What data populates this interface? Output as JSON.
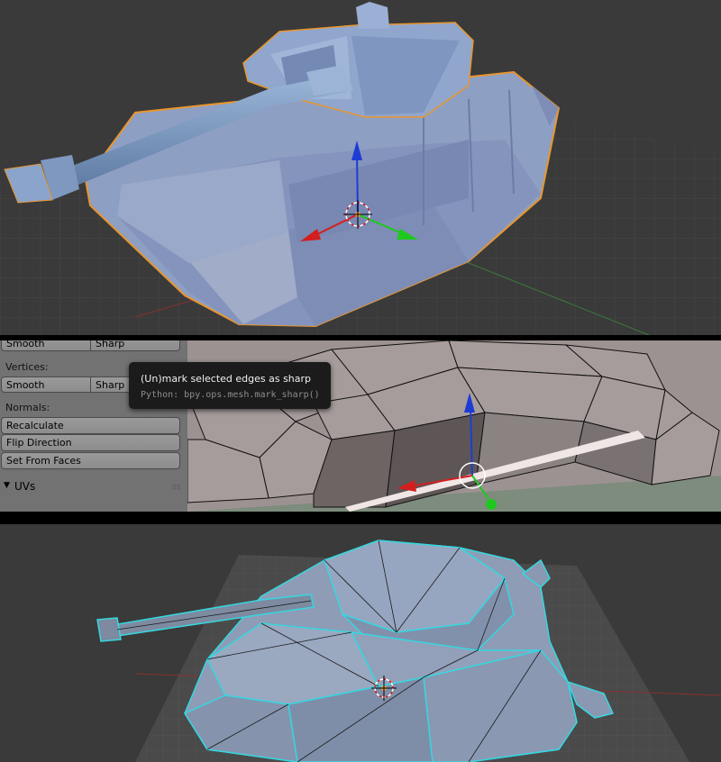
{
  "tool_shelf": {
    "top_row": {
      "smooth": "Smooth",
      "sharp": "Sharp"
    },
    "vertices_label": "Vertices:",
    "vertices_row": {
      "smooth": "Smooth",
      "sharp": "Sharp"
    },
    "normals_label": "Normals:",
    "normals_buttons": [
      "Recalculate",
      "Flip Direction",
      "Set From Faces"
    ],
    "uvs_panel": "UVs"
  },
  "tooltip": {
    "title": "(Un)mark selected edges as sharp",
    "python": "Python: bpy.ops.mesh.mark_sharp()"
  },
  "icons": {
    "manipulator": "transform-manipulator-icon",
    "cursor": "3d-cursor-icon",
    "panel_toggle": "triangle-down-icon",
    "drag": "grip-icon"
  },
  "colors": {
    "viewport_bg": "#3a3a3a",
    "mesh_blue": "#8a9ec2",
    "selection_outline": "#e8962e",
    "wireframe_cyan": "#35d7e0",
    "axis_x": "#d41e1e",
    "axis_y": "#1ec81e",
    "axis_z": "#1e3cd4"
  }
}
